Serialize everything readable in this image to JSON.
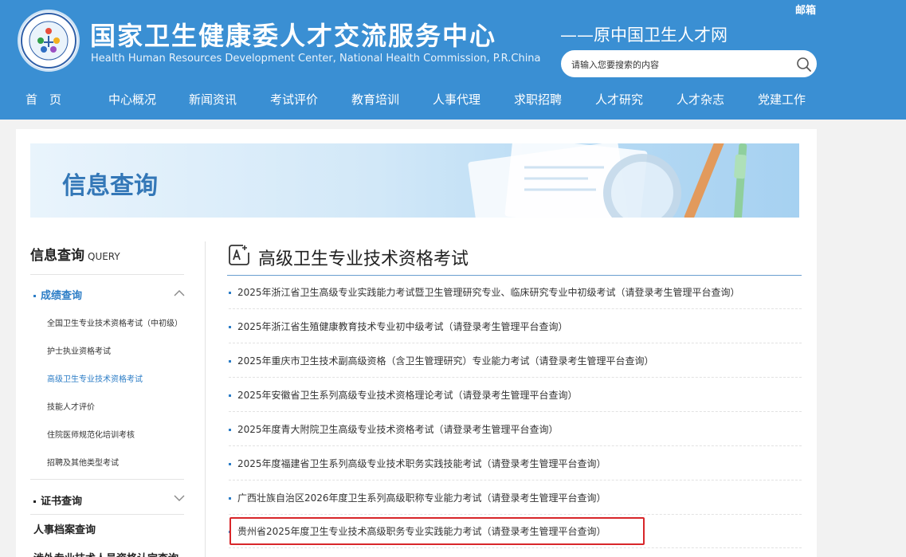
{
  "header": {
    "title_cn": "国家卫生健康委人才交流服务中心",
    "title_en": "Health Human Resources Development Center, National Health Commission, P.R.China",
    "slogan": "——原中国卫生人才网",
    "mail_label": "邮箱",
    "search_placeholder": "请输入您要搜索的内容"
  },
  "nav": {
    "items": [
      "首　页",
      "中心概况",
      "新闻资讯",
      "考试评价",
      "教育培训",
      "人事代理",
      "求职招聘",
      "人才研究",
      "人才杂志",
      "党建工作"
    ]
  },
  "banner": {
    "title": "信息查询"
  },
  "sidebar": {
    "title": "信息查询",
    "title_en": "QUERY",
    "groups": [
      {
        "label": "成绩查询",
        "expanded": true,
        "items": [
          "全国卫生专业技术资格考试（中初级）",
          "护士执业资格考试",
          "高级卫生专业技术资格考试",
          "技能人才评价",
          "住院医师规范化培训考核",
          "招聘及其他类型考试"
        ],
        "active_index": 2
      },
      {
        "label": "证书查询",
        "expanded": false
      },
      {
        "label": "人事档案查询"
      },
      {
        "label": "涉外专业技术人员资格认定查询"
      }
    ]
  },
  "main": {
    "title": "高级卫生专业技术资格考试",
    "items": [
      "2025年浙江省卫生高级专业实践能力考试暨卫生管理研究专业、临床研究专业中初级考试（请登录考生管理平台查询）",
      "2025年浙江省生殖健康教育技术专业初中级考试（请登录考生管理平台查询）",
      "2025年重庆市卫生技术副高级资格（含卫生管理研究）专业能力考试（请登录考生管理平台查询）",
      "2025年安徽省卫生系列高级专业技术资格理论考试（请登录考生管理平台查询）",
      "2025年度青大附院卫生高级专业技术资格考试（请登录考生管理平台查询）",
      "2025年度福建省卫生系列高级专业技术职务实践技能考试（请登录考生管理平台查询）",
      "广西壮族自治区2026年度卫生系列高级职称专业能力考试（请登录考生管理平台查询）",
      "贵州省2025年度卫生专业技术高级职务专业实践能力考试（请登录考生管理平台查询）"
    ],
    "highlighted_index": 7
  },
  "colors": {
    "header_bg": "#3a8fd3",
    "accent": "#2c7dc6",
    "highlight_border": "#d8262a"
  },
  "icons": {
    "search": "search-icon",
    "chevron_up": "chevron-up-icon",
    "chevron_down": "chevron-down-icon",
    "title": "edit-sparkle-icon"
  }
}
